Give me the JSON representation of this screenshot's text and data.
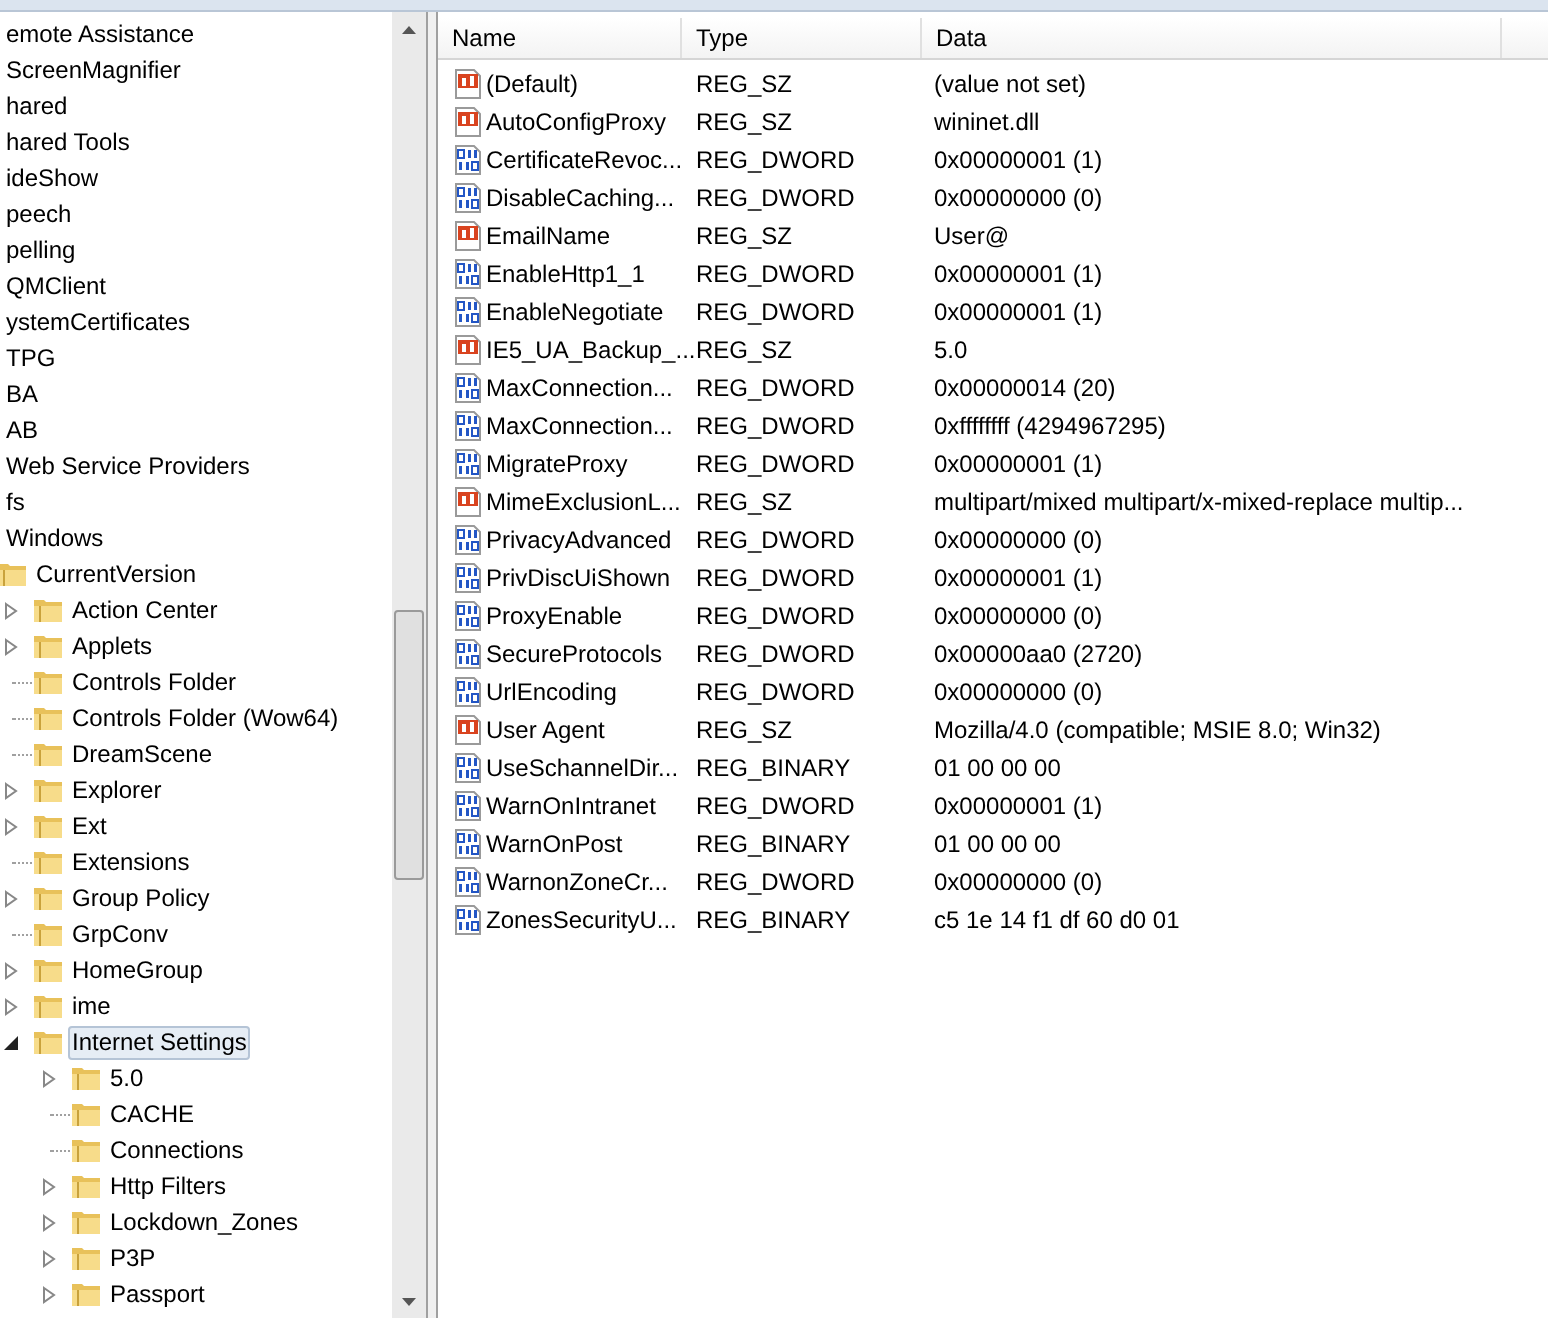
{
  "tree": [
    {
      "label": "emote Assistance",
      "selected": false
    },
    {
      "label": "ScreenMagnifier",
      "selected": false
    },
    {
      "label": "hared",
      "selected": false
    },
    {
      "label": "hared Tools",
      "selected": false
    },
    {
      "label": "ideShow",
      "selected": false
    },
    {
      "label": "peech",
      "selected": false
    },
    {
      "label": "pelling",
      "selected": false
    },
    {
      "label": "QMClient",
      "selected": false
    },
    {
      "label": "ystemCertificates",
      "selected": false
    },
    {
      "label": "TPG",
      "selected": false
    },
    {
      "label": "BA",
      "selected": false
    },
    {
      "label": "AB",
      "selected": false
    },
    {
      "label": "Web Service Providers",
      "selected": false
    },
    {
      "label": "fs",
      "selected": false
    },
    {
      "label": "Windows",
      "selected": false,
      "children": [
        {
          "label": "CurrentVersion",
          "selected": false,
          "children": [
            {
              "label": "Action Center",
              "expanded": false,
              "selected": false
            },
            {
              "label": "Applets",
              "expanded": false,
              "selected": false
            },
            {
              "label": "Controls Folder",
              "selected": false
            },
            {
              "label": "Controls Folder (Wow64)",
              "selected": false
            },
            {
              "label": "DreamScene",
              "selected": false
            },
            {
              "label": "Explorer",
              "expanded": false,
              "selected": false
            },
            {
              "label": "Ext",
              "expanded": false,
              "selected": false
            },
            {
              "label": "Extensions",
              "selected": false
            },
            {
              "label": "Group Policy",
              "expanded": false,
              "selected": false
            },
            {
              "label": "GrpConv",
              "selected": false
            },
            {
              "label": "HomeGroup",
              "expanded": false,
              "selected": false
            },
            {
              "label": "ime",
              "expanded": false,
              "selected": false
            },
            {
              "label": "Internet Settings",
              "expanded": true,
              "selected": true,
              "children": [
                {
                  "label": "5.0",
                  "expanded": false,
                  "selected": false
                },
                {
                  "label": "CACHE",
                  "selected": false
                },
                {
                  "label": "Connections",
                  "selected": false
                },
                {
                  "label": "Http Filters",
                  "expanded": false,
                  "selected": false
                },
                {
                  "label": "Lockdown_Zones",
                  "expanded": false,
                  "selected": false
                },
                {
                  "label": "P3P",
                  "expanded": false,
                  "selected": false
                },
                {
                  "label": "Passport",
                  "expanded": false,
                  "selected": false
                }
              ]
            }
          ]
        }
      ]
    }
  ],
  "values": {
    "columns": [
      "Name",
      "Type",
      "Data"
    ],
    "rows": [
      {
        "kind": "string",
        "name": "(Default)",
        "type": "REG_SZ",
        "data": "(value not set)"
      },
      {
        "kind": "string",
        "name": "AutoConfigProxy",
        "type": "REG_SZ",
        "data": "wininet.dll"
      },
      {
        "kind": "binary",
        "name": "CertificateRevoc...",
        "type": "REG_DWORD",
        "data": "0x00000001 (1)"
      },
      {
        "kind": "binary",
        "name": "DisableCaching...",
        "type": "REG_DWORD",
        "data": "0x00000000 (0)"
      },
      {
        "kind": "string",
        "name": "EmailName",
        "type": "REG_SZ",
        "data": "User@"
      },
      {
        "kind": "binary",
        "name": "EnableHttp1_1",
        "type": "REG_DWORD",
        "data": "0x00000001 (1)"
      },
      {
        "kind": "binary",
        "name": "EnableNegotiate",
        "type": "REG_DWORD",
        "data": "0x00000001 (1)"
      },
      {
        "kind": "string",
        "name": "IE5_UA_Backup_...",
        "type": "REG_SZ",
        "data": "5.0"
      },
      {
        "kind": "binary",
        "name": "MaxConnection...",
        "type": "REG_DWORD",
        "data": "0x00000014 (20)"
      },
      {
        "kind": "binary",
        "name": "MaxConnection...",
        "type": "REG_DWORD",
        "data": "0xffffffff (4294967295)"
      },
      {
        "kind": "binary",
        "name": "MigrateProxy",
        "type": "REG_DWORD",
        "data": "0x00000001 (1)"
      },
      {
        "kind": "string",
        "name": "MimeExclusionL...",
        "type": "REG_SZ",
        "data": "multipart/mixed multipart/x-mixed-replace multip..."
      },
      {
        "kind": "binary",
        "name": "PrivacyAdvanced",
        "type": "REG_DWORD",
        "data": "0x00000000 (0)"
      },
      {
        "kind": "binary",
        "name": "PrivDiscUiShown",
        "type": "REG_DWORD",
        "data": "0x00000001 (1)"
      },
      {
        "kind": "binary",
        "name": "ProxyEnable",
        "type": "REG_DWORD",
        "data": "0x00000000 (0)"
      },
      {
        "kind": "binary",
        "name": "SecureProtocols",
        "type": "REG_DWORD",
        "data": "0x00000aa0 (2720)"
      },
      {
        "kind": "binary",
        "name": "UrlEncoding",
        "type": "REG_DWORD",
        "data": "0x00000000 (0)"
      },
      {
        "kind": "string",
        "name": "User Agent",
        "type": "REG_SZ",
        "data": "Mozilla/4.0 (compatible; MSIE 8.0; Win32)"
      },
      {
        "kind": "binary",
        "name": "UseSchannelDir...",
        "type": "REG_BINARY",
        "data": "01 00 00 00"
      },
      {
        "kind": "binary",
        "name": "WarnOnIntranet",
        "type": "REG_DWORD",
        "data": "0x00000001 (1)"
      },
      {
        "kind": "binary",
        "name": "WarnOnPost",
        "type": "REG_BINARY",
        "data": "01 00 00 00"
      },
      {
        "kind": "binary",
        "name": "WarnonZoneCr...",
        "type": "REG_DWORD",
        "data": "0x00000000 (0)"
      },
      {
        "kind": "binary",
        "name": "ZonesSecurityU...",
        "type": "REG_BINARY",
        "data": "c5 1e 14 f1 df 60 d0 01"
      }
    ]
  }
}
